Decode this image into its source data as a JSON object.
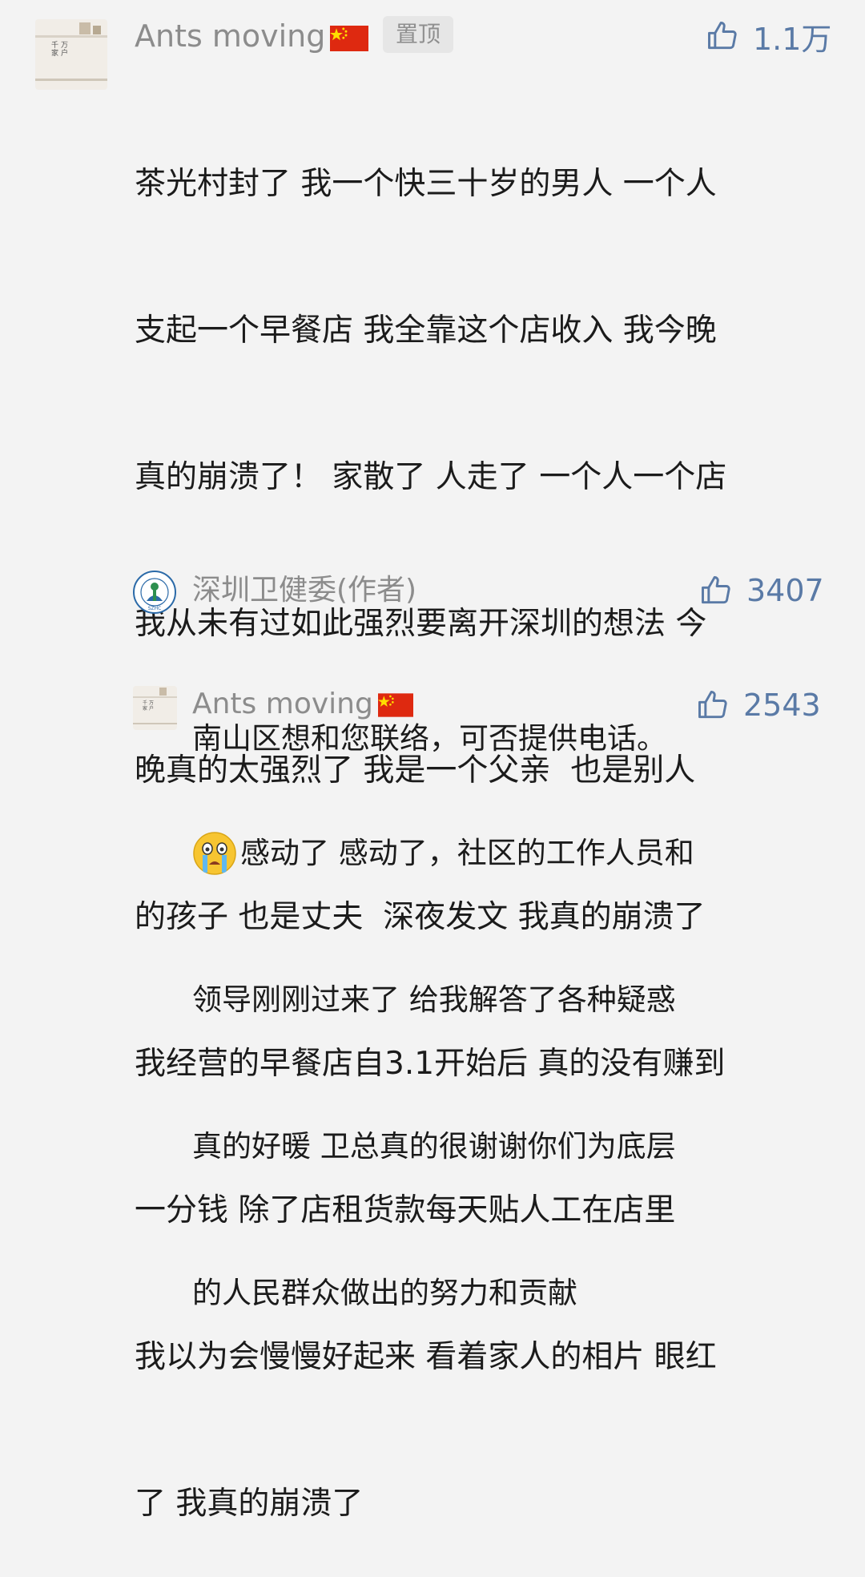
{
  "comment": {
    "author": "Ants moving",
    "pin_label": "置顶",
    "likes": "1.1万",
    "lines": [
      "茶光村封了 我一个快三十岁的男人 一个人",
      "支起一个早餐店 我全靠这个店收入 我今晚",
      "真的崩溃了！ 家散了 人走了 一个人一个店",
      "我从未有过如此强烈要离开深圳的想法 今",
      "晚真的太强烈了 我是一个父亲  也是别人",
      "的孩子 也是丈夫  深夜发文 我真的崩溃了",
      "我经营的早餐店自3.1开始后 真的没有赚到",
      "一分钱 除了店租货款每天贴人工在店里",
      "我以为会慢慢好起来 看着家人的相片 眼红",
      "了 我真的崩溃了"
    ]
  },
  "reply1": {
    "author": "深圳卫健委(作者)",
    "likes": "3407",
    "lines": [
      "南山区想和您联络，可否提供电话。"
    ],
    "logo_text": "SZHC"
  },
  "reply2": {
    "author": "Ants moving",
    "likes": "2543",
    "lines": [
      "感动了 感动了，社区的工作人员和",
      "领导刚刚过来了 给我解答了各种疑惑",
      "真的好暖 卫总真的很谢谢你们为底层",
      "的人民群众做出的努力和贡献"
    ]
  },
  "icons": {
    "like": "thumbs-up-icon",
    "flag": "china-flag-icon",
    "emoji": "crying-face-emoji-icon"
  },
  "colors": {
    "like": "#5a7aa6",
    "name": "#8c8c8c",
    "text": "#1b1b1b",
    "background": "#f3f3f3"
  }
}
